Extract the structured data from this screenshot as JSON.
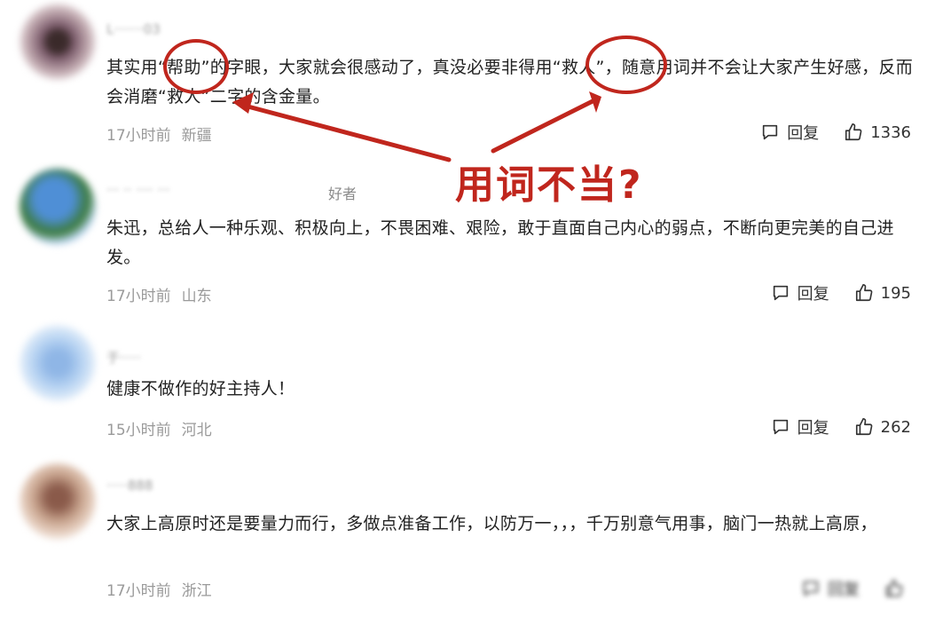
{
  "comments": [
    {
      "username": "L·······03",
      "text": "其实用“帮助”的字眼，大家就会很感动了，真没必要非得用“救人”，随意用词并不会让大家产生好感，反而会消磨“救人”二字的含金量。",
      "time": "17小时前",
      "location": "新疆",
      "reply_label": "回复",
      "likes": "1336",
      "avatar_colors": [
        "#7a5a6a",
        "#3a2a2a",
        "#c9b3b8"
      ]
    },
    {
      "username": "··· ·· ···· ···",
      "name_tag": "好者",
      "text": "朱迅，总给人一种乐观、积极向上，不畏困难、艰险，敢于直面自己内心的弱点，不断向更完美的自己进发。",
      "time": "17小时前",
      "location": "山东",
      "reply_label": "回复",
      "likes": "195",
      "avatar_colors": [
        "#4f8fd6",
        "#3b7a3a",
        "#b9d4ef"
      ]
    },
    {
      "username": "于·····",
      "text": "健康不做作的好主持人！",
      "time": "15小时前",
      "location": "河北",
      "reply_label": "回复",
      "likes": "262",
      "avatar_colors": [
        "#b7d3f2",
        "#dbe9f8",
        "#8fb6e6"
      ]
    },
    {
      "username": "·····888",
      "text": "大家上高原时还是要量力而行，多做点准备工作，以防万一，，，千万别意气用事，脑门一热就上高原，",
      "time": "17小时前",
      "location": "浙江",
      "reply_label": "回复",
      "likes": "",
      "avatar_colors": [
        "#c8a48e",
        "#8a5a4a",
        "#e6cfc0"
      ]
    }
  ],
  "annotation": {
    "label": "用词不当?",
    "color": "#c0261d"
  }
}
